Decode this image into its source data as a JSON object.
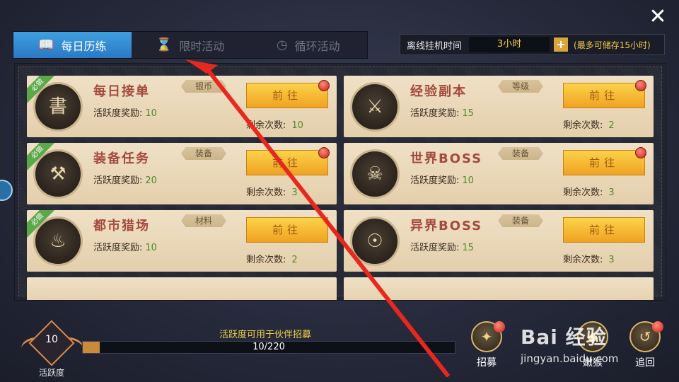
{
  "close": {
    "symbol": "✕"
  },
  "tabs": [
    {
      "label": "每日历练",
      "icon": "📖",
      "active": true
    },
    {
      "label": "限时活动",
      "icon": "⌛",
      "active": false
    },
    {
      "label": "循环活动",
      "icon": "◷",
      "active": false
    }
  ],
  "offline": {
    "label": "离线挂机时间",
    "value": "3小时",
    "plus": "+",
    "note": "(最多可储存15小时)"
  },
  "cards": [
    {
      "badge": "必做",
      "name": "每日接单",
      "tag": "银币",
      "reward_label": "活跃度奖励:",
      "reward": "10",
      "button": "前往",
      "remain_label": "剩余次数:",
      "remain": "10",
      "icon": "書"
    },
    {
      "badge": "",
      "name": "经验副本",
      "tag": "等级",
      "reward_label": "活跃度奖励:",
      "reward": "15",
      "button": "前往",
      "remain_label": "剩余次数:",
      "remain": "2",
      "icon": "⚔"
    },
    {
      "badge": "必做",
      "name": "装备任务",
      "tag": "装备",
      "reward_label": "活跃度奖励:",
      "reward": "20",
      "button": "前往",
      "remain_label": "剩余次数:",
      "remain": "3",
      "icon": "⚒"
    },
    {
      "badge": "",
      "name": "世界BOSS",
      "tag": "装备",
      "reward_label": "活跃度奖励:",
      "reward": "10",
      "button": "前往",
      "remain_label": "剩余次数:",
      "remain": "3",
      "icon": "☠"
    },
    {
      "badge": "必做",
      "name": "都市猎场",
      "tag": "材料",
      "reward_label": "活跃度奖励:",
      "reward": "10",
      "button": "前往",
      "remain_label": "剩余次数:",
      "remain": "2",
      "icon": "♨"
    },
    {
      "badge": "",
      "name": "异界BOSS",
      "tag": "装备",
      "reward_label": "活跃度奖励:",
      "reward": "15",
      "button": "前往",
      "remain_label": "剩余次数:",
      "remain": "3",
      "icon": "☉"
    }
  ],
  "activity": {
    "value": "10",
    "label": "活跃度",
    "caption": "活跃度可用于伙伴招募",
    "progress_text": "10/220",
    "progress_fraction": 0.045
  },
  "bottom_buttons": [
    {
      "label": "招募",
      "icon": "✦"
    },
    {
      "label": "嫩猴",
      "icon": "◆"
    },
    {
      "label": "追回",
      "icon": "↺"
    }
  ],
  "watermark": {
    "main": "Bai 经验",
    "sub": "jingyan.baidu.com"
  }
}
